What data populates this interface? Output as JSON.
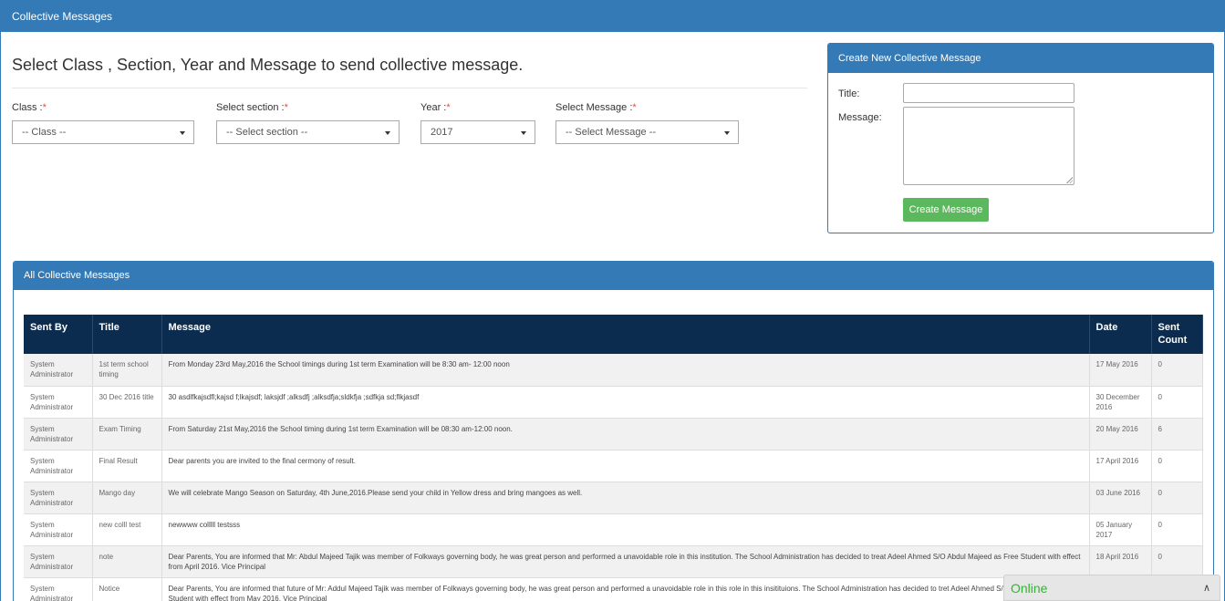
{
  "header": {
    "title": "Collective Messages"
  },
  "main": {
    "heading": "Select Class , Section, Year and Message to send collective message."
  },
  "filters": [
    {
      "label": "Class :",
      "required": "*",
      "value": "-- Class --"
    },
    {
      "label": "Select section :",
      "required": "*",
      "value": "-- Select section --"
    },
    {
      "label": "Year :",
      "required": "*",
      "value": "2017"
    },
    {
      "label": "Select Message :",
      "required": "*",
      "value": "-- Select Message --"
    }
  ],
  "create_panel": {
    "title": "Create New Collective Message",
    "title_label": "Title:",
    "message_label": "Message:",
    "button_label": "Create Message"
  },
  "list_panel": {
    "title": "All Collective Messages",
    "columns": [
      "Sent By",
      "Title",
      "Message",
      "Date",
      "Sent Count"
    ],
    "rows": [
      {
        "sent_by": "System Administrator",
        "title": "1st term school timing",
        "message": "From Monday 23rd May,2016 the School timings during 1st term Examination will be 8:30 am- 12:00 noon",
        "date": "17 May 2016",
        "count": "0"
      },
      {
        "sent_by": "System Administrator",
        "title": "30 Dec 2016 title",
        "message": "30 asdlfkajsdfl;kajsd f;lkajsdf; laksjdf ;alksdfj ;alksdfja;sldkfja ;sdfkja sd;flkjasdf",
        "date": "30 December 2016",
        "count": "0"
      },
      {
        "sent_by": "System Administrator",
        "title": "Exam Timing",
        "message": "From Saturday 21st May,2016 the School timing during 1st term Examination will be 08:30 am-12:00 noon.",
        "date": "20 May 2016",
        "count": "6"
      },
      {
        "sent_by": "System Administrator",
        "title": "Final Result",
        "message": "Dear parents you are invited to the final cermony of result.",
        "date": "17 April 2016",
        "count": "0"
      },
      {
        "sent_by": "System Administrator",
        "title": "Mango day",
        "message": "We will celebrate Mango Season on Saturday, 4th June,2016.Please send your child in Yellow dress and bring mangoes as well.",
        "date": "03 June 2016",
        "count": "0"
      },
      {
        "sent_by": "System Administrator",
        "title": "new colll test",
        "message": "newwww colllll testsss",
        "date": "05 January 2017",
        "count": "0"
      },
      {
        "sent_by": "System Administrator",
        "title": "note",
        "message": "Dear Parents, You are informed that Mr: Abdul Majeed Tajik was member of Folkways governing body, he was great person and performed a unavoidable role in this institution. The School Administration has decided to treat Adeel Ahmed S/O Abdul Majeed as Free Student with effect from April 2016. Vice Principal",
        "date": "18 April 2016",
        "count": "0"
      },
      {
        "sent_by": "System Administrator",
        "title": "Notice",
        "message": "Dear Parents, You are informed that future of Mr: Addul Majeed Tajik was member of Folkways governing body, he was great person and performed a unavoidable role in this role in this insitituions. The School Administration has decided to tret Adeel Ahmed S/O Abdul Majeed as Free Student with effect from May 2016. Vice Principal",
        "date": "",
        "count": ""
      }
    ]
  },
  "chat": {
    "status": "Online",
    "toggle_icon": "chevron-up-icon"
  }
}
